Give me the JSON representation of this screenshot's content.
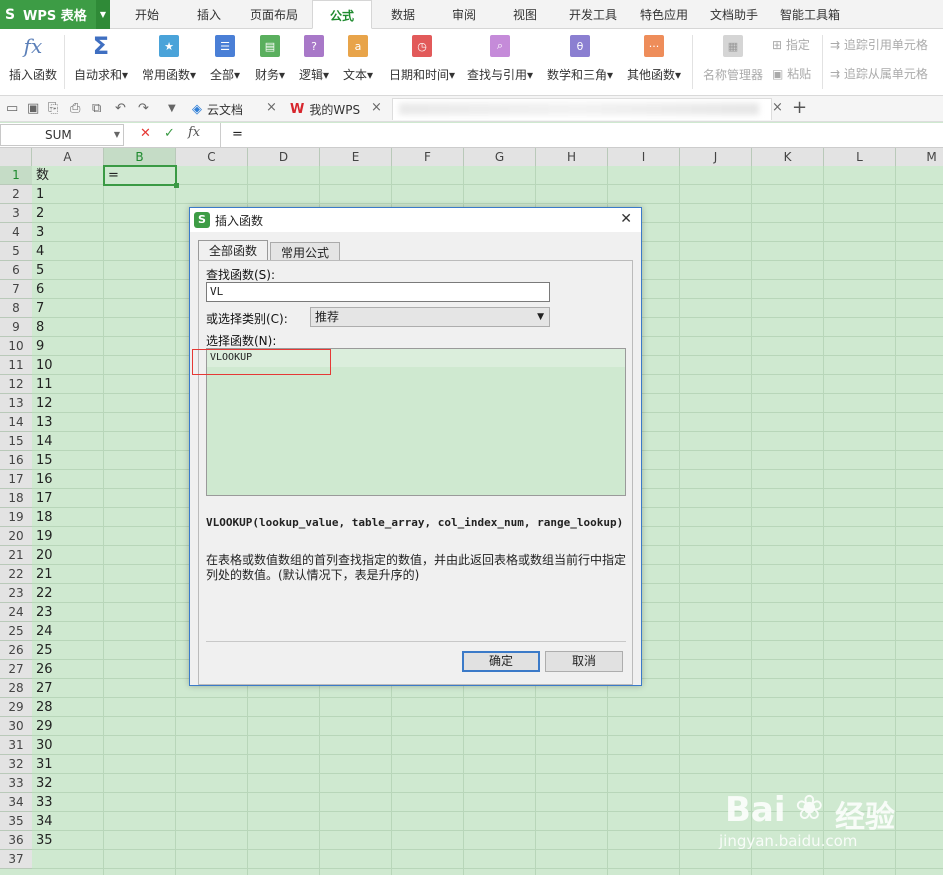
{
  "app": {
    "logo": "S",
    "name": "WPS 表格",
    "arrow": "▼"
  },
  "menu_tabs": [
    "开始",
    "插入",
    "页面布局",
    "公式",
    "数据",
    "审阅",
    "视图",
    "开发工具",
    "特色应用",
    "文档助手",
    "智能工具箱"
  ],
  "active_menu_tab": "公式",
  "ribbon": {
    "insert_function": "插入函数",
    "autosum": "自动求和",
    "common_functions": "常用函数",
    "all": "全部",
    "finance": "财务",
    "logic": "逻辑",
    "text": "文本",
    "datetime": "日期和时间",
    "lookup": "查找与引用",
    "math": "数学和三角",
    "other": "其他函数",
    "name_manager": "名称管理器",
    "specify": "指定",
    "paste": "粘贴",
    "trace_precedents": "追踪引用单元格",
    "trace_dependents": "追踪从属单元格",
    "dropdown_arrow": "▾"
  },
  "doc_tabs": {
    "cloud": "云文档",
    "mywps": "我的WPS",
    "close": "×",
    "add": "+"
  },
  "formula_bar": {
    "name_box": "SUM",
    "cancel": "✕",
    "confirm": "✓",
    "fx": "fx",
    "content": "="
  },
  "grid": {
    "columns": [
      "A",
      "B",
      "C",
      "D",
      "E",
      "F",
      "G",
      "H",
      "I",
      "J",
      "K",
      "L",
      "M"
    ],
    "row_numbers": [
      "1",
      "2",
      "3",
      "4",
      "5",
      "6",
      "7",
      "8",
      "9",
      "10",
      "11",
      "12",
      "13",
      "14",
      "15",
      "16",
      "17",
      "18",
      "19",
      "20",
      "21",
      "22",
      "23",
      "24",
      "25",
      "26",
      "27",
      "28",
      "29",
      "30",
      "31",
      "32",
      "33",
      "34",
      "35",
      "36",
      "37"
    ],
    "col_a_values": [
      "数",
      "1",
      "2",
      "3",
      "4",
      "5",
      "6",
      "7",
      "8",
      "9",
      "10",
      "11",
      "12",
      "13",
      "14",
      "15",
      "16",
      "17",
      "18",
      "19",
      "20",
      "21",
      "22",
      "23",
      "24",
      "25",
      "26",
      "27",
      "28",
      "29",
      "30",
      "31",
      "32",
      "33",
      "34",
      "35",
      ""
    ],
    "b1_value": "="
  },
  "dialog": {
    "title": "插入函数",
    "close": "✕",
    "tab_all": "全部函数",
    "tab_common": "常用公式",
    "search_label": "查找函数(S):",
    "search_value": "VL",
    "category_label": "或选择类别(C):",
    "category_value": "推荐",
    "select_label": "选择函数(N):",
    "functions": [
      "VLOOKUP"
    ],
    "signature": "VLOOKUP(lookup_value, table_array, col_index_num, range_lookup)",
    "description": "在表格或数值数组的首列查找指定的数值，并由此返回表格或数组当前行中指定列处的数值。(默认情况下，表是升序的)",
    "ok": "确定",
    "cancel": "取消"
  },
  "watermark": {
    "brand": "Bai",
    "brand2": "经验",
    "url": "jingyan.baidu.com"
  },
  "colors": {
    "accent": "#3d9c45",
    "sheet_bg": "#cfe9d0",
    "highlight_border": "#e53935",
    "dialog_border": "#3b7ac8"
  }
}
